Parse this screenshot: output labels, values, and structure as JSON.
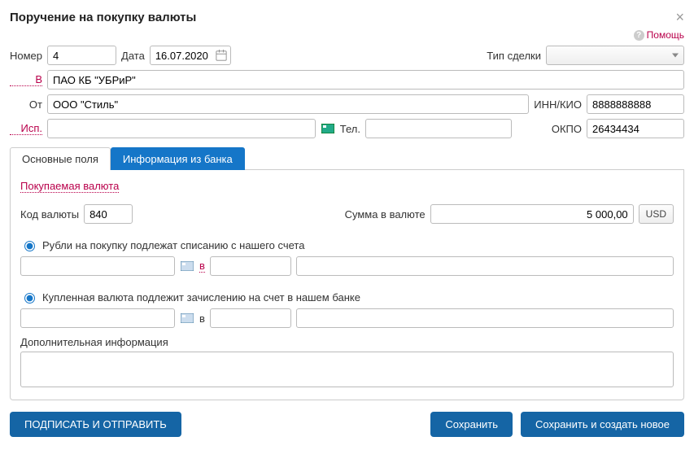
{
  "title": "Поручение на покупку валюты",
  "help": "Помощь",
  "labels": {
    "number": "Номер",
    "date": "Дата",
    "deal_type": "Тип сделки",
    "in_bank": "В",
    "from": "От",
    "inn_kio": "ИНН/КИО",
    "isp": "Исп.",
    "tel": "Тел.",
    "okpo": "ОКПО",
    "currency_code": "Код валюты",
    "amount": "Сумма в валюте",
    "in": "в",
    "addl": "Дополнительная информация"
  },
  "values": {
    "number": "4",
    "date": "16.07.2020",
    "bank": "ПАО КБ \"УБРиР\"",
    "from": "ООО \"Стиль\"",
    "inn": "8888888888",
    "isp": "",
    "tel": "",
    "okpo": "26434434",
    "currency_code": "840",
    "amount": "5 000,00",
    "currency_unit": "USD"
  },
  "tabs": {
    "main": "Основные поля",
    "bankinfo": "Информация из банка"
  },
  "section": {
    "buying": "Покупаемая валюта"
  },
  "radios": {
    "debit": "Рубли на покупку подлежат списанию с нашего счета",
    "credit": "Купленная валюта подлежит зачислению на счет в нашем банке"
  },
  "buttons": {
    "sign_send": "ПОДПИСАТЬ И ОТПРАВИТЬ",
    "save": "Сохранить",
    "save_new": "Сохранить и создать новое"
  }
}
